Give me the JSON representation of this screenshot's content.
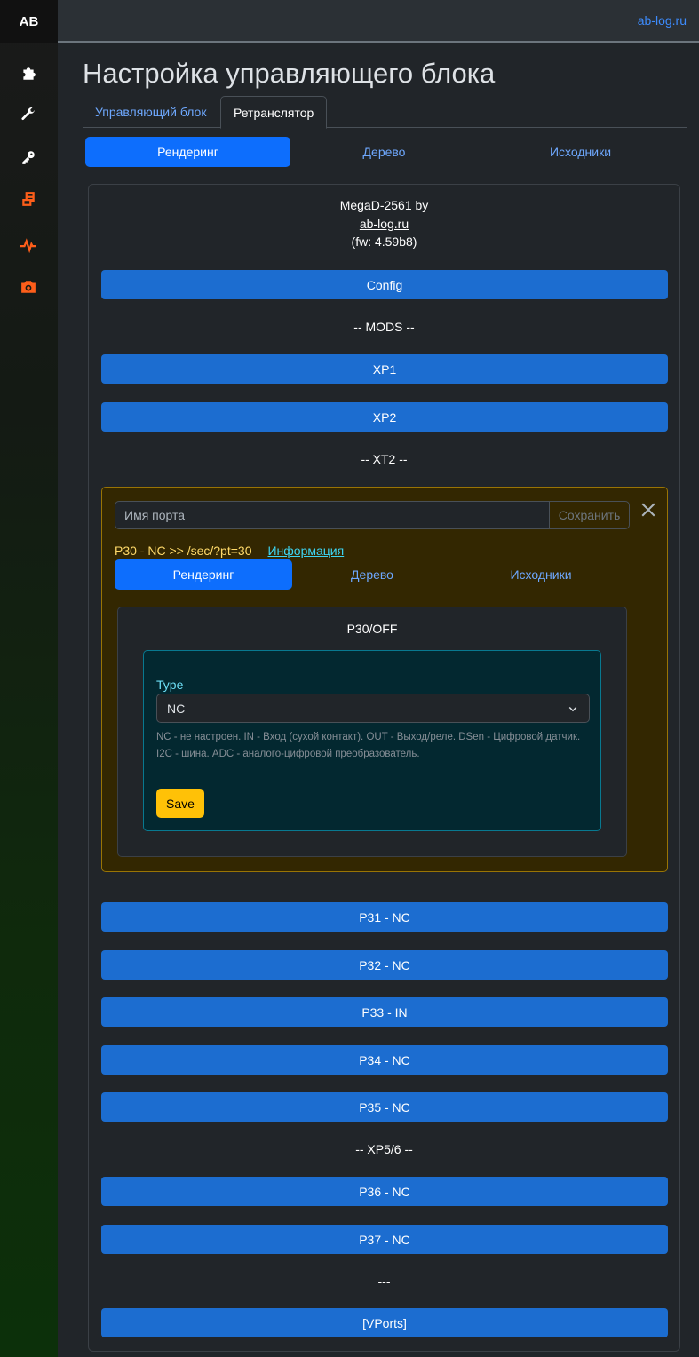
{
  "sidebar": {
    "logo": "AB",
    "icons": [
      {
        "name": "puzzle-icon",
        "color": "#ffffff"
      },
      {
        "name": "wrench-icon",
        "color": "#ffffff"
      },
      {
        "name": "key-icon",
        "color": "#ffffff"
      },
      {
        "name": "scroll-icon",
        "color": "#fd5e1a"
      },
      {
        "name": "heartbeat-icon",
        "color": "#fd5e1a"
      },
      {
        "name": "camera-icon",
        "color": "#fd5e1a"
      }
    ]
  },
  "topbar": {
    "link": "ab-log.ru"
  },
  "page": {
    "title": "Настройка управляющего блока"
  },
  "top_tabs": [
    "Управляющий блок",
    "Ретранслятор"
  ],
  "view_tabs": [
    "Рендеринг",
    "Дерево",
    "Исходники"
  ],
  "device": {
    "name": "MegaD-2561 by",
    "link": "ab-log.ru",
    "fw": "(fw: 4.59b8)"
  },
  "buttons": {
    "config": "Config",
    "xp1": "XP1",
    "xp2": "XP2",
    "p31": "P31 - NC",
    "p32": "P32 - NC",
    "p33": "P33 - IN",
    "p34": "P34 - NC",
    "p35": "P35 - NC",
    "p36": "P36 - NC",
    "p37": "P37 - NC",
    "vports": "[VPorts]"
  },
  "sections": {
    "mods": "-- MODS --",
    "xt2": "-- XT2 --",
    "xp56": "-- XP5/6 --",
    "sep": "---"
  },
  "port_panel": {
    "name_placeholder": "Имя порта",
    "save_label": "Сохранить",
    "info_text": "P30 - NC >> /sec/?pt=30",
    "info_link": "Информация",
    "tabs": [
      "Рендеринг",
      "Дерево",
      "Исходники"
    ],
    "card_title": "P30/OFF",
    "type_label": "Type",
    "type_value": "NC",
    "help_text": "NC - не настроен. IN - Вход (сухой контакт). OUT - Выход/реле. DSen - Цифровой датчик. I2C - шина. ADC - аналого-цифровой преобразователь.",
    "save_button": "Save"
  }
}
